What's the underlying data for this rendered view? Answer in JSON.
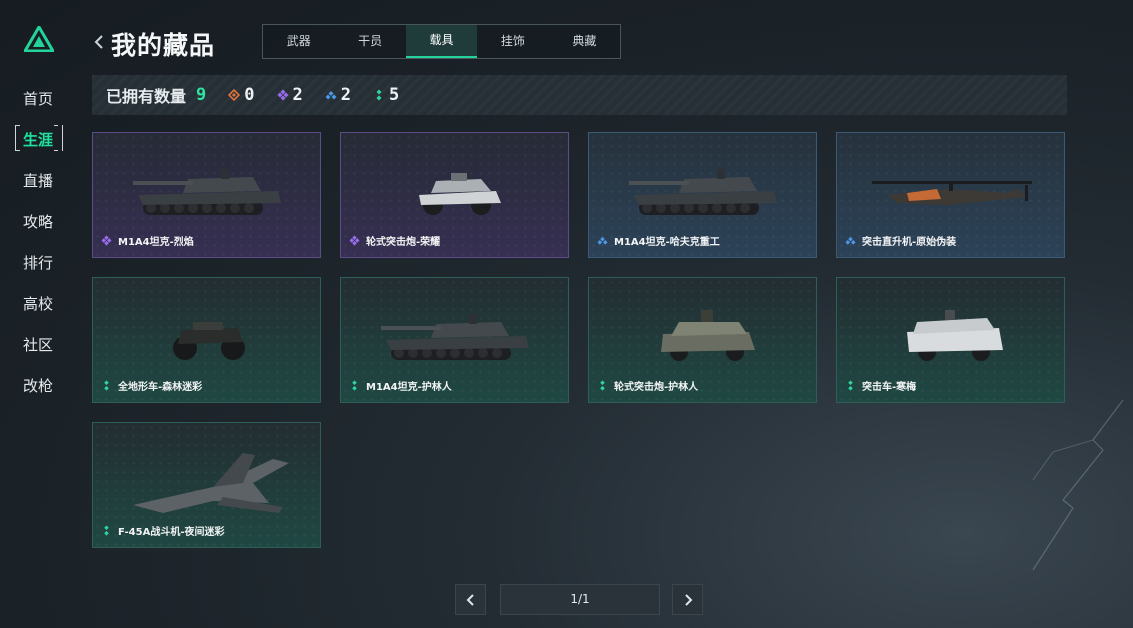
{
  "sidebar": {
    "items": [
      {
        "label": "首页",
        "active": false
      },
      {
        "label": "生涯",
        "active": true
      },
      {
        "label": "直播",
        "active": false
      },
      {
        "label": "攻略",
        "active": false
      },
      {
        "label": "排行",
        "active": false
      },
      {
        "label": "高校",
        "active": false
      },
      {
        "label": "社区",
        "active": false
      },
      {
        "label": "改枪",
        "active": false
      }
    ]
  },
  "header": {
    "title": "我的藏品",
    "tabs": [
      {
        "label": "武器",
        "active": false
      },
      {
        "label": "干员",
        "active": false
      },
      {
        "label": "载具",
        "active": true
      },
      {
        "label": "挂饰",
        "active": false
      },
      {
        "label": "典藏",
        "active": false
      }
    ]
  },
  "stats": {
    "label": "已拥有数量",
    "total": "9",
    "rarities": [
      {
        "icon": "orange-diamond-icon",
        "color": "#e0743a",
        "count": "0"
      },
      {
        "icon": "purple-diamond-icon",
        "color": "#9a6cf0",
        "count": "2"
      },
      {
        "icon": "blue-diamond-icon",
        "color": "#4a9ae8",
        "count": "2"
      },
      {
        "icon": "green-diamond-icon",
        "color": "#2fd69c",
        "count": "5"
      }
    ]
  },
  "items": [
    {
      "name": "M1A4坦克-烈焰",
      "rarity": "purple",
      "kind": "tank"
    },
    {
      "name": "轮式突击炮-荣耀",
      "rarity": "purple",
      "kind": "buggy"
    },
    {
      "name": "M1A4坦克-哈夫克重工",
      "rarity": "blue",
      "kind": "tank"
    },
    {
      "name": "突击直升机-原始伪装",
      "rarity": "blue",
      "kind": "heli"
    },
    {
      "name": "全地形车-森林迷彩",
      "rarity": "green",
      "kind": "atv"
    },
    {
      "name": "M1A4坦克-护林人",
      "rarity": "green",
      "kind": "tank"
    },
    {
      "name": "轮式突击炮-护林人",
      "rarity": "green",
      "kind": "apc"
    },
    {
      "name": "突击车-寒梅",
      "rarity": "green",
      "kind": "truck"
    },
    {
      "name": "F-45A战斗机-夜间迷彩",
      "rarity": "green",
      "kind": "jet"
    }
  ],
  "pagination": {
    "label": "1/1"
  },
  "colors": {
    "accent": "#23d39a",
    "purple": "#9a6cf0",
    "blue": "#4a9ae8",
    "green": "#2fd69c"
  }
}
